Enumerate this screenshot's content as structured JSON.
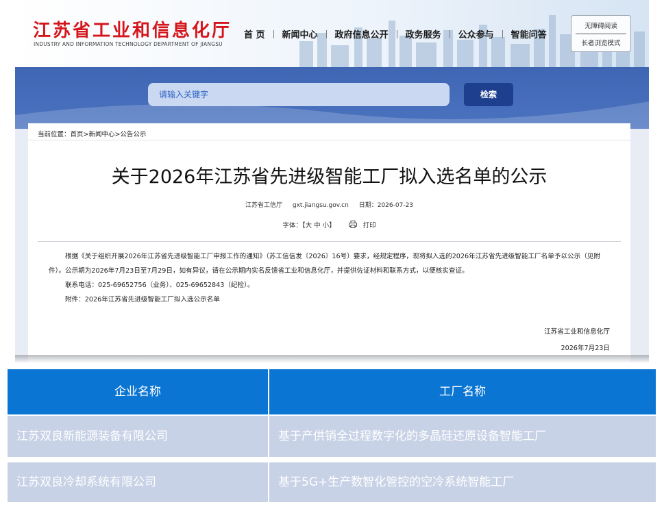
{
  "header": {
    "logo_cn": "江苏省工业和信息化厅",
    "logo_en": "INDUSTRY AND INFORMATION TECHNOLOGY DEPARTMENT OF JIANGSU",
    "nav": [
      "首 页",
      "新闻中心",
      "政府信息公开",
      "政务服务",
      "公众参与",
      "智能问答"
    ],
    "accessibility": "无障碍阅读",
    "elder_mode": "长者浏览模式"
  },
  "search": {
    "placeholder": "请输入关键字",
    "button": "检索"
  },
  "article": {
    "breadcrumb": "当前位置：首页>新闻中心>公告公示",
    "title": "关于2026年江苏省先进级智能工厂拟入选名单的公示",
    "source": "江苏省工信厅",
    "site": "gxt.jiangsu.gov.cn",
    "date": "日期：2026-07-23",
    "font_label": "字体：【大 中 小】",
    "print_icon": "printer-icon",
    "print": "打印",
    "para1": "根据《关于组织开展2026年江苏省先进级智能工厂申报工作的通知》（苏工信信发〔2026〕16号）要求，经规定程序，现将拟入选的2026年江苏省先进级智能工厂名单予以公示（见附件）。公示期为2026年7月23日至7月29日，如有异议，请在公示期内实名反馈省工业和信息化厅，并提供佐证材料和联系方式，以便核实查证。",
    "phone": "联系电话：025-69652756（业务）、025-69652843（纪检）。",
    "attachment": "附件：2026年江苏省先进级智能工厂拟入选公示名单",
    "signer": "江苏省工业和信息化厅",
    "sign_date": "2026年7月23日"
  },
  "table": {
    "headers": [
      "企业名称",
      "工厂名称"
    ],
    "rows": [
      [
        "江苏双良新能源装备有限公司",
        "基于产供销全过程数字化的多晶硅还原设备智能工厂"
      ],
      [
        "江苏双良冷却系统有限公司",
        "基于5G+生产数智化管控的空冷系统智能工厂"
      ]
    ]
  },
  "colors": {
    "logo_red": "#d4161c",
    "band_blue": "#4b73c0",
    "search_button": "#1d3f8e",
    "table_header": "#0a75d2",
    "table_row": "#c8d2e6"
  }
}
